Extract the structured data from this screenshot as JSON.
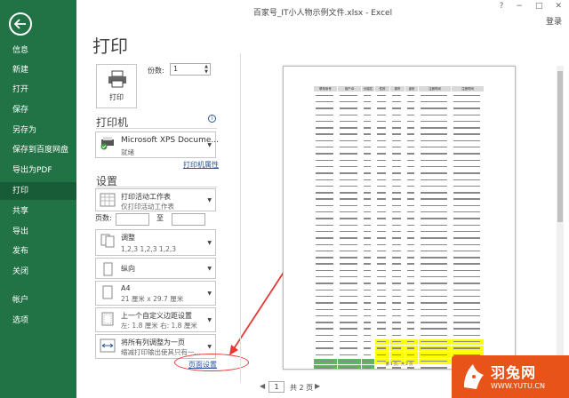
{
  "window": {
    "title": "百家号_IT小人物示例文件.xlsx - Excel",
    "login_label": "登录",
    "ctrl_help": "?",
    "ctrl_min": "−",
    "ctrl_max": "□",
    "ctrl_close": "✕"
  },
  "sidebar": {
    "items": [
      {
        "label": "信息"
      },
      {
        "label": "新建"
      },
      {
        "label": "打开"
      },
      {
        "label": "保存"
      },
      {
        "label": "另存为"
      },
      {
        "label": "保存到百度网盘"
      },
      {
        "label": "导出为PDF"
      },
      {
        "label": "打印"
      },
      {
        "label": "共享"
      },
      {
        "label": "导出"
      },
      {
        "label": "发布"
      },
      {
        "label": "关闭"
      },
      {
        "label": "帐户"
      },
      {
        "label": "选项"
      }
    ],
    "active_index": 7
  },
  "page": {
    "title": "打印"
  },
  "print": {
    "button_label": "打印",
    "copies_label": "份数:",
    "copies_value": "1"
  },
  "printer": {
    "section_title": "打印机",
    "name": "Microsoft XPS Docume...",
    "status": "就绪",
    "properties_link": "打印机属性",
    "info": "i"
  },
  "settings": {
    "section_title": "设置",
    "what": {
      "main": "打印活动工作表",
      "sub": "仅打印活动工作表"
    },
    "pages_label": "页数:",
    "pages_to": "至",
    "collate": {
      "main": "调整",
      "sub": "1,2,3    1,2,3    1,2,3"
    },
    "orientation": {
      "main": "纵向"
    },
    "paper": {
      "main": "A4",
      "sub": "21 厘米 x 29.7 厘米"
    },
    "margins": {
      "main": "上一个自定义边距设置",
      "sub": "左: 1.8 厘米    右: 1.8 厘米"
    },
    "scaling": {
      "main": "将所有列调整为一页",
      "sub": "缩减打印输出使其只有一..."
    },
    "page_setup_link": "页面设置"
  },
  "pager": {
    "current": "1",
    "total": "共 2 页",
    "prev": "◀",
    "next": "▶"
  },
  "preview": {
    "headers": [
      "联系序号",
      "用户ID",
      "分组名",
      "性别",
      "城市",
      "省份",
      "注册时间",
      "注册时间"
    ],
    "row_count": 44,
    "page_footer": "第 1 页，共 2 页"
  },
  "watermark": {
    "brand_cn": "羽兔网",
    "url": "WWW.YUTU.CN"
  },
  "colors": {
    "sidebar": "#217346",
    "active": "#185c37",
    "accent": "#2b579a",
    "annotation": "#e53935",
    "highlight_yellow": "#ffff00",
    "highlight_green": "#5cb85c",
    "logo": "#e8531a"
  }
}
